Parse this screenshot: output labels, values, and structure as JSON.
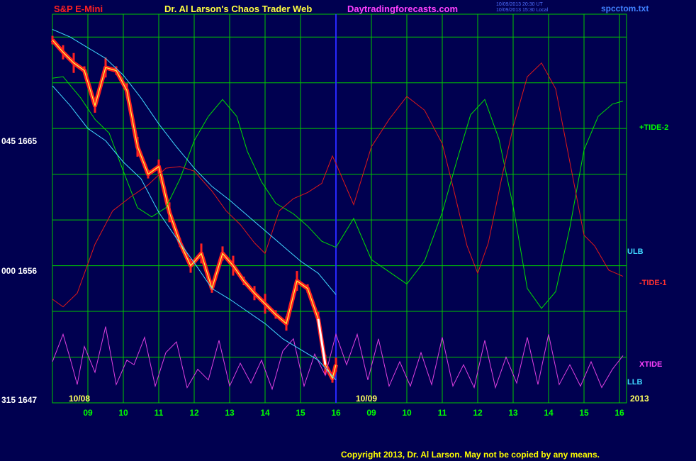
{
  "header": {
    "symbol": "S&P E-Mini",
    "title": "Dr. Al Larson's Chaos Trader Web",
    "site": "Daytradingforecasts.com",
    "time_utc": "10/09/2013 20:30 UT",
    "time_local": "10/09/2013 15:30 Local",
    "file": "spcctom.txt"
  },
  "colors": {
    "background": "#000050",
    "grid": "#00c800",
    "price": "#ff2020",
    "price_recent": "#ffffff",
    "smooth": "#ffff40",
    "tide2": "#00e000",
    "tide1": "#e01818",
    "xtide": "#e040e0",
    "bands": "#40d8ff",
    "now_line": "#2828ff"
  },
  "labels": {
    "y_top": "045 1665",
    "y_mid": "000 1656",
    "y_bot": "315 1647",
    "date_start": "10/08",
    "date_now": "10/09",
    "year": "2013",
    "tide2": "+TIDE-2",
    "ulb": "ULB",
    "tide1": "-TIDE-1",
    "xtide": "XTIDE",
    "llb": "LLB"
  },
  "copyright": "Copyright 2013, Dr. Al Larson. May not be copied by any means.",
  "chart_data": {
    "type": "line",
    "title": "S&P E-Mini",
    "x_labels": [
      "09",
      "10",
      "11",
      "12",
      "13",
      "14",
      "15",
      "16",
      "09",
      "10",
      "11",
      "12",
      "13",
      "14",
      "15",
      "16"
    ],
    "date_markers": [
      "10/08",
      "10/09",
      "2013"
    ],
    "y_axis_labels": [
      "045 1665",
      "000 1656",
      "315 1647"
    ],
    "ylim": [
      1647,
      1672.5
    ],
    "xlim": [
      0,
      16.2
    ],
    "now_x": 8.0,
    "grid": true,
    "series": [
      {
        "name": "S&P E-Mini",
        "x": [
          0,
          0.3,
          0.6,
          0.9,
          1.2,
          1.5,
          1.8,
          2.1,
          2.4,
          2.7,
          3.0,
          3.3,
          3.6,
          3.9,
          4.2,
          4.5,
          4.8,
          5.1,
          5.4,
          5.7,
          6.0,
          6.3,
          6.6,
          6.9,
          7.2,
          7.5,
          7.7,
          7.9,
          8.0
        ],
        "y": [
          1670.8,
          1670,
          1669.3,
          1668.8,
          1666.5,
          1669,
          1668.8,
          1667.5,
          1663.8,
          1662,
          1662.5,
          1659.5,
          1657.5,
          1656,
          1656.8,
          1654.5,
          1656.8,
          1656,
          1655,
          1654.2,
          1653.5,
          1652.8,
          1652.2,
          1655,
          1654.5,
          1652.5,
          1649.5,
          1648.6,
          1649.5
        ]
      },
      {
        "name": "+TIDE-2",
        "x": [
          0,
          0.3,
          0.8,
          1.2,
          1.6,
          2.0,
          2.4,
          2.8,
          3.2,
          3.6,
          4.0,
          4.4,
          4.8,
          5.2,
          5.5,
          5.9,
          6.3,
          6.8,
          7.2,
          7.6,
          8.0,
          8.5,
          9.0,
          9.5,
          10.0,
          10.5,
          11.0,
          11.4,
          11.8,
          12.2,
          12.6,
          13.0,
          13.4,
          13.8,
          14.2,
          14.6,
          15.0,
          15.4,
          15.8,
          16.1
        ],
        "y": [
          1668.3,
          1668.4,
          1667,
          1665.6,
          1664.7,
          1662.2,
          1659.8,
          1659.2,
          1659.8,
          1661.7,
          1664.2,
          1665.8,
          1666.9,
          1665.8,
          1663.5,
          1661.5,
          1660.1,
          1659.4,
          1658.6,
          1657.6,
          1657.2,
          1659.1,
          1656.4,
          1655.6,
          1654.8,
          1656.3,
          1659.5,
          1662.8,
          1665.9,
          1666.9,
          1664.3,
          1659.9,
          1654.5,
          1653.2,
          1654.3,
          1658.5,
          1663.6,
          1665.8,
          1666.6,
          1666.8
        ]
      },
      {
        "name": "-TIDE-1",
        "x": [
          0,
          0.3,
          0.7,
          1.2,
          1.7,
          2.2,
          2.7,
          3.2,
          3.6,
          4.0,
          4.5,
          4.9,
          5.3,
          5.7,
          6.0,
          6.4,
          6.8,
          7.2,
          7.6,
          7.9,
          8.0,
          8.5,
          9.0,
          9.5,
          10.0,
          10.5,
          11.0,
          11.3,
          11.7,
          12.0,
          12.3,
          12.7,
          13.0,
          13.4,
          13.8,
          14.2,
          14.6,
          15.0,
          15.3,
          15.7,
          16.1
        ],
        "y": [
          1653.8,
          1653.3,
          1654.2,
          1657.4,
          1659.6,
          1660.5,
          1661.3,
          1662.4,
          1662.5,
          1662.2,
          1660.9,
          1659.6,
          1658.7,
          1657.5,
          1656.8,
          1659.6,
          1660.4,
          1660.8,
          1661.4,
          1663.2,
          1662.7,
          1660,
          1663.8,
          1665.6,
          1667.1,
          1666.2,
          1664,
          1661.2,
          1657.3,
          1655.5,
          1657.5,
          1662,
          1665.1,
          1668.4,
          1669.3,
          1667.6,
          1662.8,
          1658,
          1657.3,
          1655.7,
          1655.3
        ]
      },
      {
        "name": "XTIDE",
        "x": [
          0,
          0.3,
          0.5,
          0.7,
          0.9,
          1.2,
          1.5,
          1.8,
          2.1,
          2.3,
          2.6,
          2.9,
          3.2,
          3.5,
          3.8,
          4.1,
          4.4,
          4.7,
          5.0,
          5.3,
          5.6,
          5.9,
          6.2,
          6.5,
          6.8,
          7.1,
          7.4,
          7.7,
          8.0,
          8.3,
          8.6,
          8.9,
          9.2,
          9.5,
          9.8,
          10.1,
          10.4,
          10.7,
          11.0,
          11.3,
          11.6,
          11.9,
          12.2,
          12.5,
          12.8,
          13.1,
          13.4,
          13.7,
          14.0,
          14.3,
          14.6,
          14.9,
          15.2,
          15.5,
          15.8,
          16.1
        ],
        "y": [
          1649.7,
          1651.5,
          1649.9,
          1648.2,
          1650.7,
          1649,
          1652,
          1648.2,
          1649.8,
          1649.5,
          1651.3,
          1648.1,
          1650.3,
          1651,
          1648,
          1649.2,
          1648.5,
          1651.1,
          1648.1,
          1649.6,
          1648.3,
          1649.8,
          1647.9,
          1650.4,
          1651.2,
          1648.1,
          1650.2,
          1648.8,
          1651.5,
          1649.5,
          1651.5,
          1648.5,
          1651.2,
          1648.1,
          1649.7,
          1648.1,
          1650.3,
          1648.2,
          1651.3,
          1648.1,
          1649.5,
          1648,
          1651.1,
          1648,
          1650,
          1648.3,
          1651.3,
          1648.2,
          1651.5,
          1648.2,
          1649.5,
          1648.1,
          1649.7,
          1648,
          1649.2,
          1650.1
        ]
      },
      {
        "name": "ULB",
        "x": [
          0,
          0.5,
          1.0,
          1.5,
          2.0,
          2.5,
          3.0,
          3.5,
          4.0,
          4.5,
          5.0,
          5.5,
          6.0,
          6.5,
          7.0,
          7.5,
          8.0
        ],
        "y": [
          1671.5,
          1671,
          1670.3,
          1669.6,
          1668.5,
          1667,
          1665.3,
          1663.8,
          1662.4,
          1661.2,
          1660.3,
          1659.3,
          1658.3,
          1657.3,
          1656.3,
          1655.5,
          1654.1
        ]
      },
      {
        "name": "LLB",
        "x": [
          0,
          0.5,
          1.0,
          1.5,
          2.0,
          2.5,
          3.0,
          3.5,
          4.0,
          4.5,
          5.0,
          5.5,
          6.0,
          6.5,
          7.0,
          7.5,
          8.0
        ],
        "y": [
          1667.8,
          1666.5,
          1665,
          1664.2,
          1662.8,
          1661.7,
          1659.5,
          1657.8,
          1656.2,
          1654.5,
          1653.8,
          1653,
          1652.2,
          1651.2,
          1650.5,
          1649.8,
          1648.5
        ]
      }
    ]
  }
}
